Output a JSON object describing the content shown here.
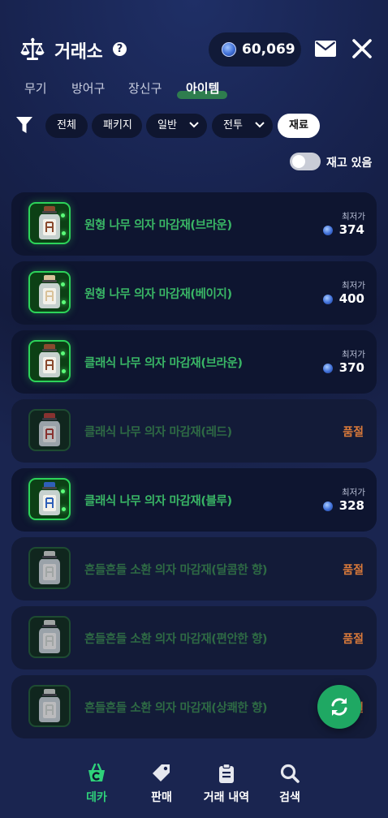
{
  "header": {
    "title": "거래소",
    "help_icon": "question-circle-icon",
    "currency_value": "60,069",
    "currency_icon": "blue-coin-icon"
  },
  "tabs": [
    {
      "label": "무기",
      "active": false
    },
    {
      "label": "방어구",
      "active": false
    },
    {
      "label": "장신구",
      "active": false
    },
    {
      "label": "아이템",
      "active": true
    }
  ],
  "filters": {
    "chips": [
      {
        "label": "전체",
        "dropdown": false,
        "active": false
      },
      {
        "label": "패키지",
        "dropdown": false,
        "active": false
      },
      {
        "label": "일반",
        "dropdown": true,
        "active": false
      },
      {
        "label": "전투",
        "dropdown": true,
        "active": false
      },
      {
        "label": "재료",
        "dropdown": false,
        "active": true
      }
    ],
    "in_stock_label": "재고 있음",
    "in_stock_on": false
  },
  "items": [
    {
      "name": "원형 나무 의자 마감재(브라운)",
      "price_label": "최저가",
      "price": "374",
      "sold_out": false,
      "lid_color": "#8a4a2e"
    },
    {
      "name": "원형 나무 의자 마감재(베이지)",
      "price_label": "최저가",
      "price": "400",
      "sold_out": false,
      "lid_color": "#d9c29a"
    },
    {
      "name": "클래식 나무 의자 마감재(브라운)",
      "price_label": "최저가",
      "price": "370",
      "sold_out": false,
      "lid_color": "#8a4a2e"
    },
    {
      "name": "클래식 나무 의자 마감재(레드)",
      "sold_label": "품절",
      "sold_out": true,
      "lid_color": "#b03a2e"
    },
    {
      "name": "클래식 나무 의자 마감재(블루)",
      "price_label": "최저가",
      "price": "328",
      "sold_out": false,
      "lid_color": "#2f5fb8"
    },
    {
      "name": "흔들흔들 소환 의자 마감재(달콤한 향)",
      "sold_label": "품절",
      "sold_out": true,
      "lid_color": "#cfd4c8"
    },
    {
      "name": "흔들흔들 소환 의자 마감재(편안한 향)",
      "sold_label": "품절",
      "sold_out": true,
      "lid_color": "#cfd4c8"
    },
    {
      "name": "흔들흔들 소환 의자 마감재(상쾌한 향)",
      "sold_label": "품절",
      "sold_out": true,
      "lid_color": "#cfd4c8"
    }
  ],
  "nav": [
    {
      "label": "데카",
      "icon": "deka-basket-icon",
      "active": true
    },
    {
      "label": "판매",
      "icon": "price-tag-icon",
      "active": false
    },
    {
      "label": "거래 내역",
      "icon": "clipboard-icon",
      "active": false
    },
    {
      "label": "검색",
      "icon": "search-icon",
      "active": false
    }
  ],
  "colors": {
    "accent_green": "#1fa863",
    "item_name_green": "#39b565",
    "sold_out_orange": "#d97a3a"
  }
}
